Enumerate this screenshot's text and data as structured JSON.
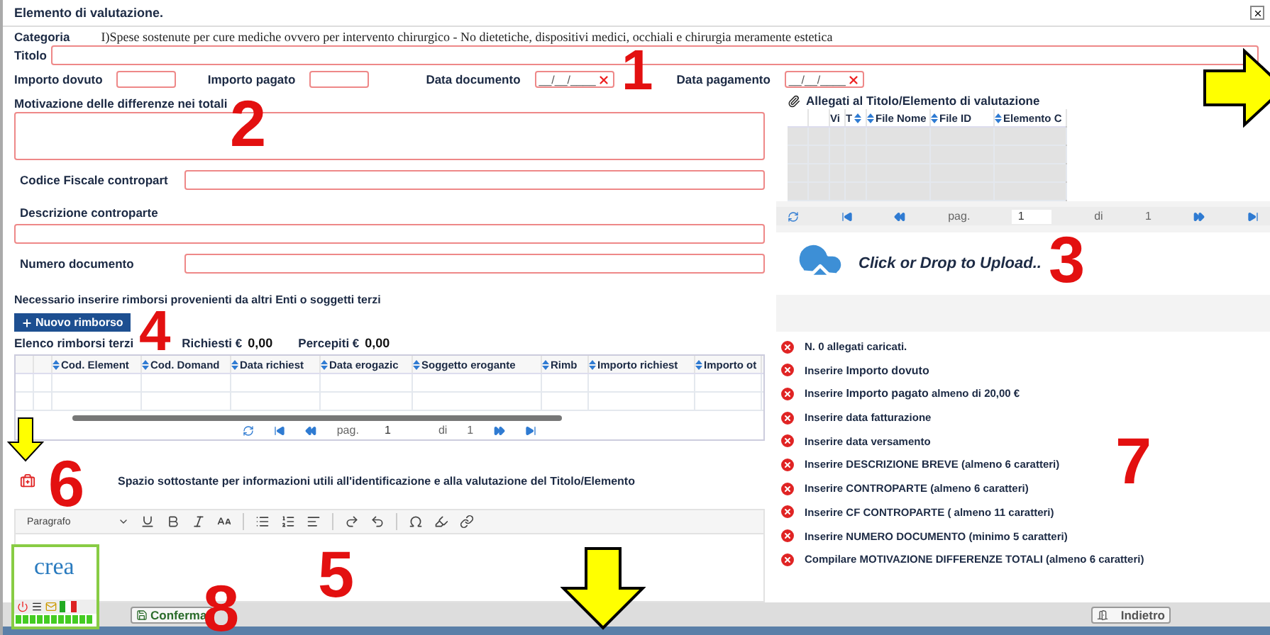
{
  "window": {
    "title": "Elemento di valutazione."
  },
  "category": {
    "label": "Categoria",
    "value": "I)Spese sostenute per cure mediche ovvero per intervento chirurgico - No dietetiche, dispositivi medici, occhiali e chirurgia meramente estetica"
  },
  "title_field": {
    "label": "Titolo"
  },
  "amounts": [
    {
      "label": "Importo dovuto",
      "kind": "amount"
    },
    {
      "label": "Importo pagato",
      "kind": "amount"
    },
    {
      "label": "Data documento",
      "kind": "date",
      "placeholder": "__/__/____"
    },
    {
      "label": "Data pagamento",
      "kind": "date",
      "placeholder": "__/__/____"
    }
  ],
  "motivation": {
    "label": "Motivazione delle differenze nei totali"
  },
  "counterpart_fields": [
    {
      "label": "Codice Fiscale contropart",
      "kind": "inline"
    },
    {
      "label": "Descrizione controparte",
      "kind": "stacked"
    },
    {
      "label": "Numero documento",
      "kind": "inline"
    }
  ],
  "reimbursements": {
    "notice": "Necessario inserire rimborsi provenienti da altri Enti o soggetti terzi",
    "new_button": "Nuovo rimborso",
    "list_label": "Elenco rimborsi terzi",
    "requested_label": "Richiesti €",
    "requested": "0,00",
    "received_label": "Percepiti €",
    "received": "0,00",
    "columns": [
      "Cod. Element",
      "Cod. Domand",
      "Data richiest",
      "Data erogazic",
      "Soggetto erogante",
      "Rimb",
      "Importo richiest",
      "Importo ot"
    ],
    "pager": {
      "page_label": "pag.",
      "page": "1",
      "of_label": "di",
      "pages": "1"
    }
  },
  "info": {
    "text": "Spazio sottostante per informazioni utili all'identificazione e alla valutazione del Titolo/Elemento"
  },
  "editor": {
    "block_format": "Paragrafo"
  },
  "attachments": {
    "title": "Allegati al Titolo/Elemento di valutazione",
    "columns": [
      "Vi",
      "T",
      "File Nome",
      "File ID",
      "Elemento C"
    ],
    "pager": {
      "page_label": "pag.",
      "page": "1",
      "of_label": "di",
      "pages": "1"
    },
    "upload": "Click or Drop to Upload.."
  },
  "validation": [
    {
      "text": "N. 0 allegati caricati."
    },
    {
      "text": "Inserire  **Importo dovuto**"
    },
    {
      "text": "Inserire  **Importo pagato** almeno di 20,00 €"
    },
    {
      "text": "Inserire data fatturazione"
    },
    {
      "text": "Inserire data versamento"
    },
    {
      "text": "Inserire DESCRIZIONE BREVE (almeno 6 caratteri)"
    },
    {
      "text": "Inserire CONTROPARTE (almeno 6 caratteri)"
    },
    {
      "text": "Inserire CF CONTROPARTE ( almeno 11 caratteri)"
    },
    {
      "text": "Inserire NUMERO DOCUMENTO (minimo 5 caratteri)"
    },
    {
      "text": "Compilare MOTIVAZIONE DIFFERENZE TOTALI (almeno 6 caratteri)"
    }
  ],
  "logo": {
    "name": "crea"
  },
  "footer": {
    "confirm": "Conferma",
    "back": "Indietro"
  },
  "annotations": [
    "1",
    "2",
    "3",
    "4",
    "5",
    "6",
    "7",
    "8"
  ]
}
